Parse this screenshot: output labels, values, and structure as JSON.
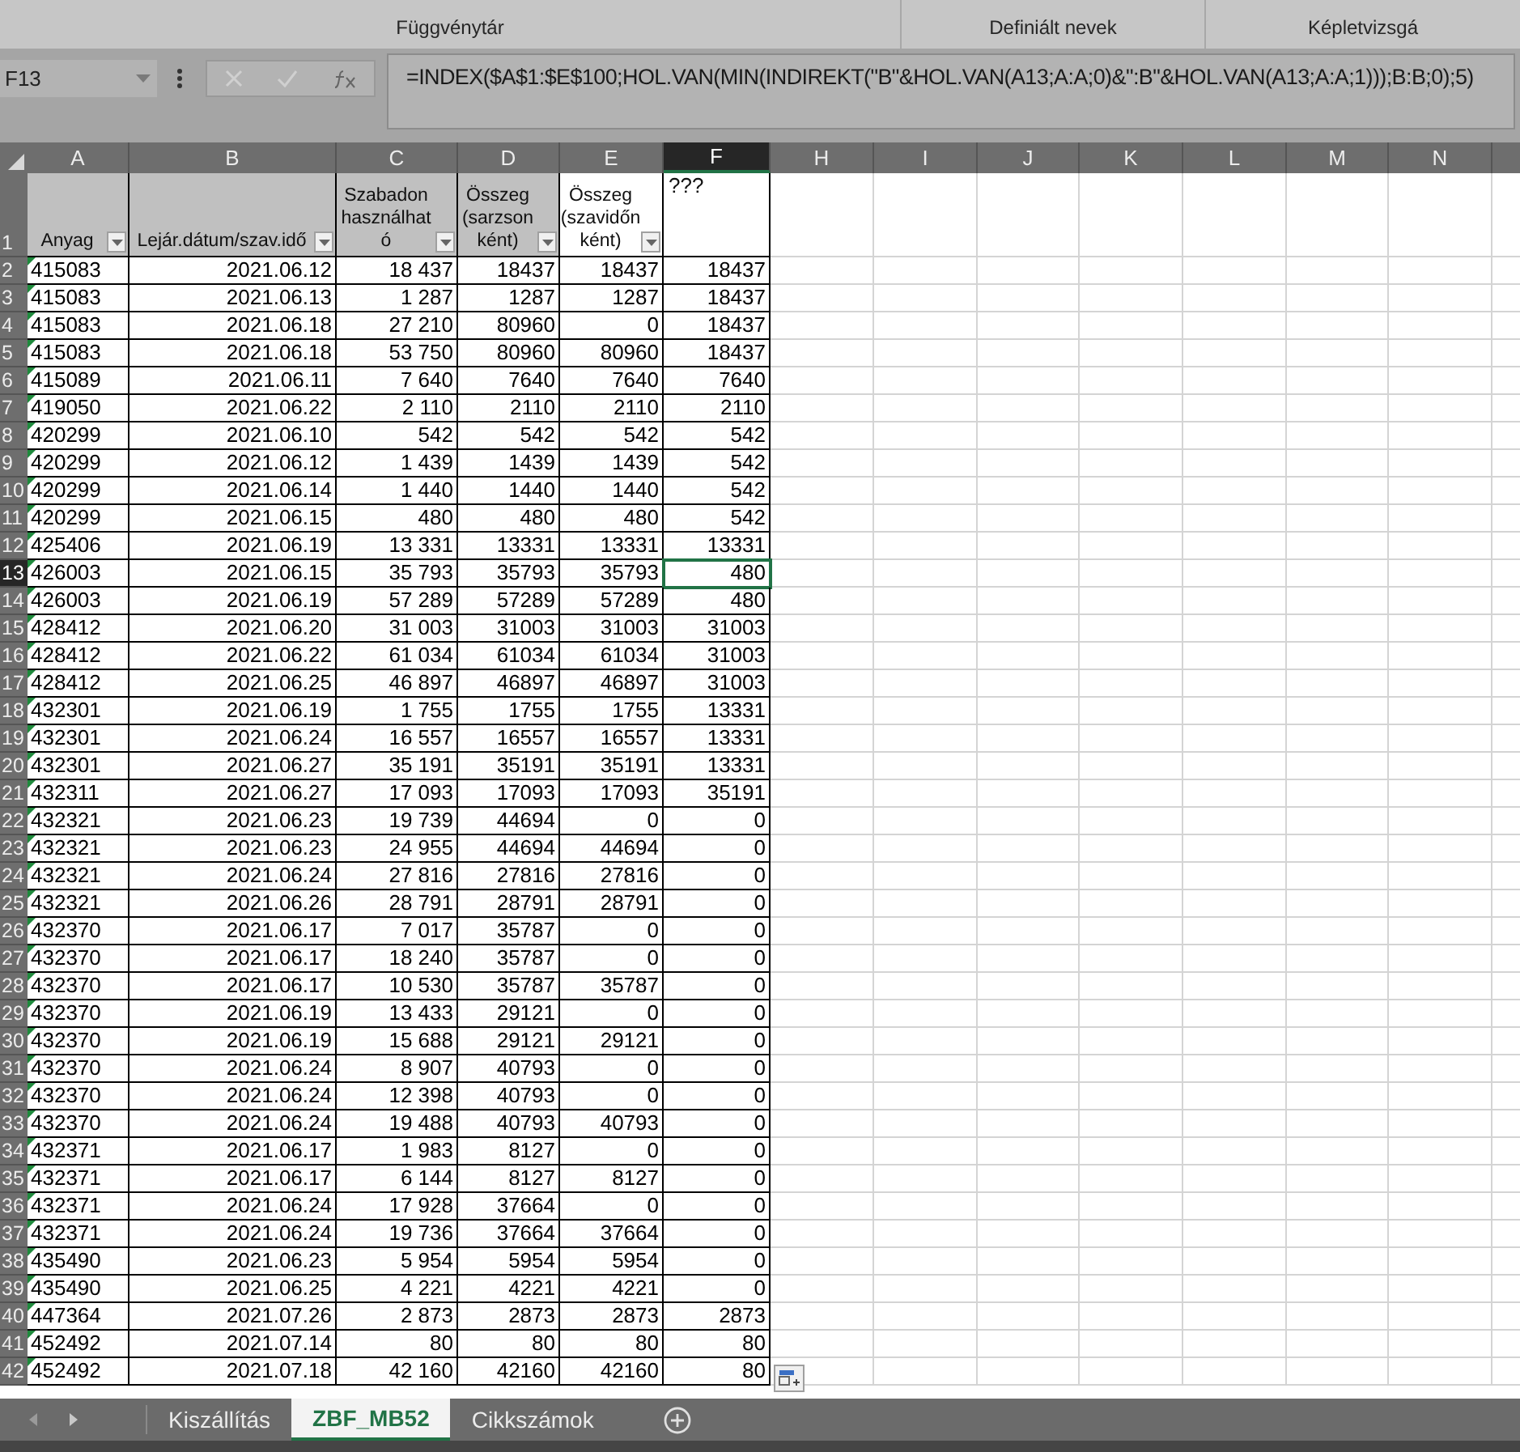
{
  "ribbon": {
    "group_labels": [
      "Függvénytár",
      "Definiált nevek",
      "Képletvizsgá"
    ]
  },
  "formula_bar": {
    "name_box": "F13",
    "formula": "=INDEX($A$1:$E$100;HOL.VAN(MIN(INDIREKT(\"B\"&HOL.VAN(A13;A:A;0)&\":B\"&HOL.VAN(A13;A:A;1)));B:B;0);5)"
  },
  "columns": [
    {
      "letter": "A",
      "selected": false
    },
    {
      "letter": "B",
      "selected": false
    },
    {
      "letter": "C",
      "selected": false
    },
    {
      "letter": "D",
      "selected": false
    },
    {
      "letter": "E",
      "selected": false
    },
    {
      "letter": "F",
      "selected": true
    },
    {
      "letter": "H",
      "selected": false
    },
    {
      "letter": "I",
      "selected": false
    },
    {
      "letter": "J",
      "selected": false
    },
    {
      "letter": "K",
      "selected": false
    },
    {
      "letter": "L",
      "selected": false
    },
    {
      "letter": "M",
      "selected": false
    },
    {
      "letter": "N",
      "selected": false
    }
  ],
  "header_row": {
    "number": "1",
    "cells": [
      {
        "text": "Anyag",
        "filter": true,
        "shaded": true
      },
      {
        "text": "Lejár.dátum/szav.idő",
        "filter": true,
        "shaded": true
      },
      {
        "text": "Szabadon használható",
        "filter": true,
        "shaded": true
      },
      {
        "text": "Összeg (sarzsonként)",
        "filter": true,
        "shaded": true
      },
      {
        "text": "Összeg (szavidőnként)",
        "filter": true,
        "shaded": false
      },
      {
        "text": "???",
        "filter": false,
        "shaded": false
      }
    ]
  },
  "rows": [
    {
      "number": "2",
      "selected": false,
      "cells": [
        "415083",
        "2021.06.12",
        "18 437",
        "18437",
        "18437",
        "18437"
      ]
    },
    {
      "number": "3",
      "selected": false,
      "cells": [
        "415083",
        "2021.06.13",
        "1 287",
        "1287",
        "1287",
        "18437"
      ]
    },
    {
      "number": "4",
      "selected": false,
      "cells": [
        "415083",
        "2021.06.18",
        "27 210",
        "80960",
        "0",
        "18437"
      ]
    },
    {
      "number": "5",
      "selected": false,
      "cells": [
        "415083",
        "2021.06.18",
        "53 750",
        "80960",
        "80960",
        "18437"
      ]
    },
    {
      "number": "6",
      "selected": false,
      "cells": [
        "415089",
        "2021.06.11",
        "7 640",
        "7640",
        "7640",
        "7640"
      ]
    },
    {
      "number": "7",
      "selected": false,
      "cells": [
        "419050",
        "2021.06.22",
        "2 110",
        "2110",
        "2110",
        "2110"
      ]
    },
    {
      "number": "8",
      "selected": false,
      "cells": [
        "420299",
        "2021.06.10",
        "542",
        "542",
        "542",
        "542"
      ]
    },
    {
      "number": "9",
      "selected": false,
      "cells": [
        "420299",
        "2021.06.12",
        "1 439",
        "1439",
        "1439",
        "542"
      ]
    },
    {
      "number": "10",
      "selected": false,
      "cells": [
        "420299",
        "2021.06.14",
        "1 440",
        "1440",
        "1440",
        "542"
      ]
    },
    {
      "number": "11",
      "selected": false,
      "cells": [
        "420299",
        "2021.06.15",
        "480",
        "480",
        "480",
        "542"
      ]
    },
    {
      "number": "12",
      "selected": false,
      "cells": [
        "425406",
        "2021.06.19",
        "13 331",
        "13331",
        "13331",
        "13331"
      ]
    },
    {
      "number": "13",
      "selected": true,
      "cells": [
        "426003",
        "2021.06.15",
        "35 793",
        "35793",
        "35793",
        "480"
      ]
    },
    {
      "number": "14",
      "selected": false,
      "cells": [
        "426003",
        "2021.06.19",
        "57 289",
        "57289",
        "57289",
        "480"
      ]
    },
    {
      "number": "15",
      "selected": false,
      "cells": [
        "428412",
        "2021.06.20",
        "31 003",
        "31003",
        "31003",
        "31003"
      ]
    },
    {
      "number": "16",
      "selected": false,
      "cells": [
        "428412",
        "2021.06.22",
        "61 034",
        "61034",
        "61034",
        "31003"
      ]
    },
    {
      "number": "17",
      "selected": false,
      "cells": [
        "428412",
        "2021.06.25",
        "46 897",
        "46897",
        "46897",
        "31003"
      ]
    },
    {
      "number": "18",
      "selected": false,
      "cells": [
        "432301",
        "2021.06.19",
        "1 755",
        "1755",
        "1755",
        "13331"
      ]
    },
    {
      "number": "19",
      "selected": false,
      "cells": [
        "432301",
        "2021.06.24",
        "16 557",
        "16557",
        "16557",
        "13331"
      ]
    },
    {
      "number": "20",
      "selected": false,
      "cells": [
        "432301",
        "2021.06.27",
        "35 191",
        "35191",
        "35191",
        "13331"
      ]
    },
    {
      "number": "21",
      "selected": false,
      "cells": [
        "432311",
        "2021.06.27",
        "17 093",
        "17093",
        "17093",
        "35191"
      ]
    },
    {
      "number": "22",
      "selected": false,
      "cells": [
        "432321",
        "2021.06.23",
        "19 739",
        "44694",
        "0",
        "0"
      ]
    },
    {
      "number": "23",
      "selected": false,
      "cells": [
        "432321",
        "2021.06.23",
        "24 955",
        "44694",
        "44694",
        "0"
      ]
    },
    {
      "number": "24",
      "selected": false,
      "cells": [
        "432321",
        "2021.06.24",
        "27 816",
        "27816",
        "27816",
        "0"
      ]
    },
    {
      "number": "25",
      "selected": false,
      "cells": [
        "432321",
        "2021.06.26",
        "28 791",
        "28791",
        "28791",
        "0"
      ]
    },
    {
      "number": "26",
      "selected": false,
      "cells": [
        "432370",
        "2021.06.17",
        "7 017",
        "35787",
        "0",
        "0"
      ]
    },
    {
      "number": "27",
      "selected": false,
      "cells": [
        "432370",
        "2021.06.17",
        "18 240",
        "35787",
        "0",
        "0"
      ]
    },
    {
      "number": "28",
      "selected": false,
      "cells": [
        "432370",
        "2021.06.17",
        "10 530",
        "35787",
        "35787",
        "0"
      ]
    },
    {
      "number": "29",
      "selected": false,
      "cells": [
        "432370",
        "2021.06.19",
        "13 433",
        "29121",
        "0",
        "0"
      ]
    },
    {
      "number": "30",
      "selected": false,
      "cells": [
        "432370",
        "2021.06.19",
        "15 688",
        "29121",
        "29121",
        "0"
      ]
    },
    {
      "number": "31",
      "selected": false,
      "cells": [
        "432370",
        "2021.06.24",
        "8 907",
        "40793",
        "0",
        "0"
      ]
    },
    {
      "number": "32",
      "selected": false,
      "cells": [
        "432370",
        "2021.06.24",
        "12 398",
        "40793",
        "0",
        "0"
      ]
    },
    {
      "number": "33",
      "selected": false,
      "cells": [
        "432370",
        "2021.06.24",
        "19 488",
        "40793",
        "40793",
        "0"
      ]
    },
    {
      "number": "34",
      "selected": false,
      "cells": [
        "432371",
        "2021.06.17",
        "1 983",
        "8127",
        "0",
        "0"
      ]
    },
    {
      "number": "35",
      "selected": false,
      "cells": [
        "432371",
        "2021.06.17",
        "6 144",
        "8127",
        "8127",
        "0"
      ]
    },
    {
      "number": "36",
      "selected": false,
      "cells": [
        "432371",
        "2021.06.24",
        "17 928",
        "37664",
        "0",
        "0"
      ]
    },
    {
      "number": "37",
      "selected": false,
      "cells": [
        "432371",
        "2021.06.24",
        "19 736",
        "37664",
        "37664",
        "0"
      ]
    },
    {
      "number": "38",
      "selected": false,
      "cells": [
        "435490",
        "2021.06.23",
        "5 954",
        "5954",
        "5954",
        "0"
      ]
    },
    {
      "number": "39",
      "selected": false,
      "cells": [
        "435490",
        "2021.06.25",
        "4 221",
        "4221",
        "4221",
        "0"
      ]
    },
    {
      "number": "40",
      "selected": false,
      "cells": [
        "447364",
        "2021.07.26",
        "2 873",
        "2873",
        "2873",
        "2873"
      ]
    },
    {
      "number": "41",
      "selected": false,
      "cells": [
        "452492",
        "2021.07.14",
        "80",
        "80",
        "80",
        "80"
      ]
    },
    {
      "number": "42",
      "selected": false,
      "cells": [
        "452492",
        "2021.07.18",
        "42 160",
        "42160",
        "42160",
        "80"
      ]
    }
  ],
  "sheet_tabs": [
    {
      "label": "Kiszállítás",
      "selected": false
    },
    {
      "label": "ZBF_MB52",
      "selected": true
    },
    {
      "label": "Cikkszámok",
      "selected": false
    }
  ]
}
